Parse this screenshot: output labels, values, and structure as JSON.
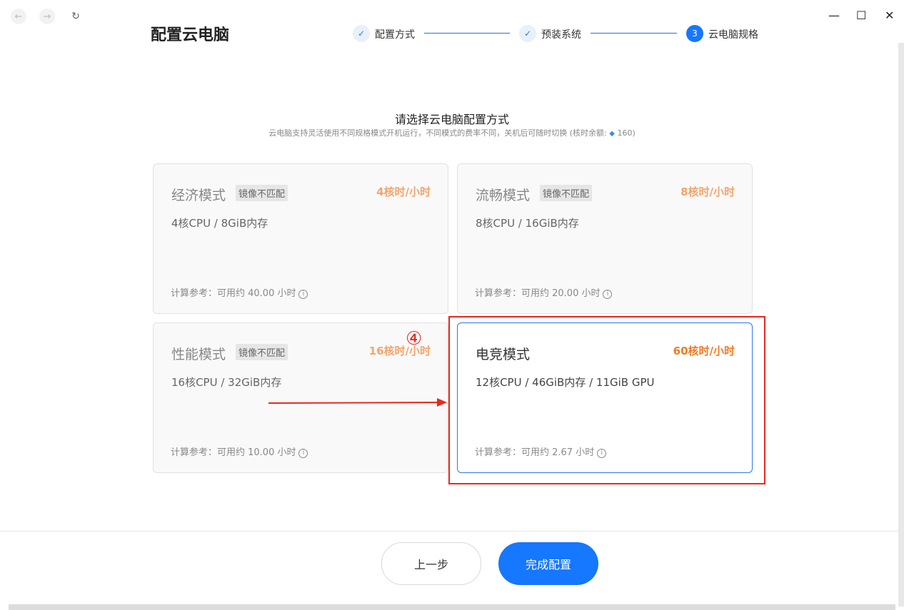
{
  "nav": {
    "back_icon": "←",
    "forward_icon": "→",
    "reload_icon": "↻"
  },
  "window": {
    "minimize": "—",
    "maximize": "☐",
    "close": "✕"
  },
  "page_title": "配置云电脑",
  "steps": [
    {
      "label": "配置方式",
      "state": "done",
      "marker": "✓"
    },
    {
      "label": "预装系统",
      "state": "done",
      "marker": "✓"
    },
    {
      "label": "云电脑规格",
      "state": "active",
      "marker": "3"
    }
  ],
  "section": {
    "title": "请选择云电脑配置方式",
    "subtitle_prefix": "云电脑支持灵活使用不同规格模式开机运行，不同模式的费率不同，关机后可随时切换 (核时余额: ",
    "balance": "160",
    "subtitle_suffix": ")"
  },
  "cards": [
    {
      "name": "经济模式",
      "badge": "镜像不匹配",
      "rate": "4核时/小时",
      "spec": "4核CPU / 8GiB内存",
      "ref": "计算参考：可用约 40.00 小时"
    },
    {
      "name": "流畅模式",
      "badge": "镜像不匹配",
      "rate": "8核时/小时",
      "spec": "8核CPU / 16GiB内存",
      "ref": "计算参考：可用约 20.00 小时"
    },
    {
      "name": "性能模式",
      "badge": "镜像不匹配",
      "rate": "16核时/小时",
      "spec": "16核CPU / 32GiB内存",
      "ref": "计算参考：可用约 10.00 小时"
    },
    {
      "name": "电竞模式",
      "badge": "",
      "rate": "60核时/小时",
      "spec": "12核CPU / 46GiB内存 / 11GiB GPU",
      "ref": "计算参考：可用约 2.67 小时",
      "selected": true
    }
  ],
  "annotation": {
    "number": "④",
    "color": "#e8281e"
  },
  "buttons": {
    "prev": "上一步",
    "done": "完成配置"
  },
  "colors": {
    "accent": "#1677ff",
    "rate_orange": "#f07b24"
  }
}
